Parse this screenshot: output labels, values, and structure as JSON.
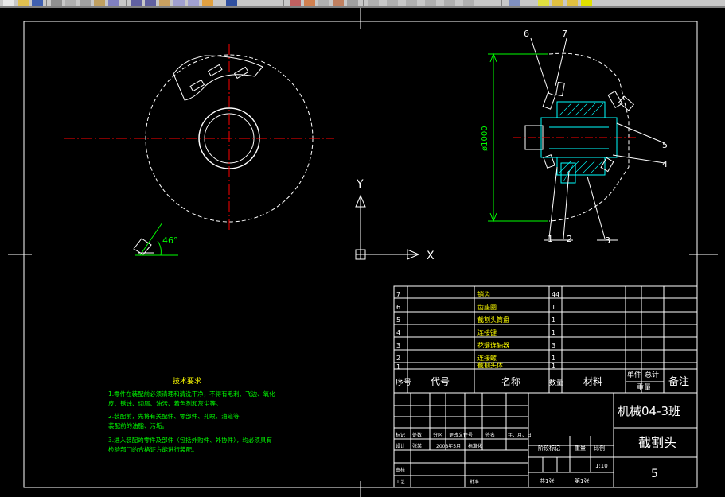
{
  "toolbar": {
    "buttons": [
      "new-file",
      "open-file",
      "save-file",
      "print",
      "cut",
      "copy",
      "paste",
      "undo",
      "redo",
      "pan",
      "zoom-realtime",
      "zoom-window",
      "zoom-previous",
      "properties",
      "design-center",
      "tool-palettes",
      "layer-manager"
    ]
  },
  "drawing": {
    "dimension_diameter": "ø1000",
    "angle_label": "46°",
    "ucs_y": "Y",
    "ucs_x": "X",
    "balloons": [
      "1",
      "2",
      "3",
      "4",
      "5",
      "6",
      "7"
    ]
  },
  "tech_requirements": {
    "title": "技术要求",
    "lines": [
      "1.零件在装配前必须清理和清洗干净，不得有毛刺、飞边、氧化",
      "皮、锈蚀、切屑、油污、着色剂和灰尘等。",
      "2.装配前，先将有关配件、零部件、孔眼、油道等",
      "装配前的油脂、污垢。",
      "3.进入装配的零件及部件（包括外购件、外协件），均必须具有",
      "检验部门的合格证方能进行装配。"
    ]
  },
  "parts_list": {
    "rows": [
      {
        "no": "7",
        "code": "",
        "name": "销齿",
        "qty": "44",
        "material": ""
      },
      {
        "no": "6",
        "code": "",
        "name": "齿座圈",
        "qty": "1",
        "material": ""
      },
      {
        "no": "5",
        "code": "",
        "name": "截割头筒盘",
        "qty": "1",
        "material": ""
      },
      {
        "no": "4",
        "code": "",
        "name": "连接键",
        "qty": "1",
        "material": ""
      },
      {
        "no": "3",
        "code": "",
        "name": "花键连轴器",
        "qty": "3",
        "material": ""
      },
      {
        "no": "2",
        "code": "",
        "name": "连接螺",
        "qty": "1",
        "material": ""
      },
      {
        "no": "1",
        "code": "",
        "name": "截割头体",
        "qty": "1",
        "material": ""
      }
    ],
    "header": {
      "no": "序号",
      "code": "代号",
      "name": "名称",
      "qty": "数量",
      "material": "材料",
      "unit_weight": "单件",
      "total_weight": "总计",
      "weight": "重量",
      "remarks": "备注"
    }
  },
  "title_block": {
    "class_name": "机械04-3班",
    "drawing_name": "截割头",
    "sheet_number": "5",
    "scale": "1:10",
    "sheets": "共1张",
    "sheet_of": "第1张",
    "stage_mark": "阶段标记",
    "weight_label": "重量",
    "scale_label": "比例",
    "mark_row": [
      "标记",
      "处数",
      "分区",
      "更改文件号",
      "签名",
      "年、月、日"
    ],
    "designer_row": [
      "设计",
      "张某",
      "2008年5月",
      "标准化"
    ],
    "review": "审核",
    "process": "工艺",
    "approve": "批准",
    "material_label": "材料"
  },
  "colors": {
    "background": "#000000",
    "frame": "#ffffff",
    "center_line": "#ff0000",
    "dim_green": "#00ff00",
    "section_cyan": "#00ffff",
    "table_line": "#ffffff",
    "text_yellow": "#ffff00"
  }
}
